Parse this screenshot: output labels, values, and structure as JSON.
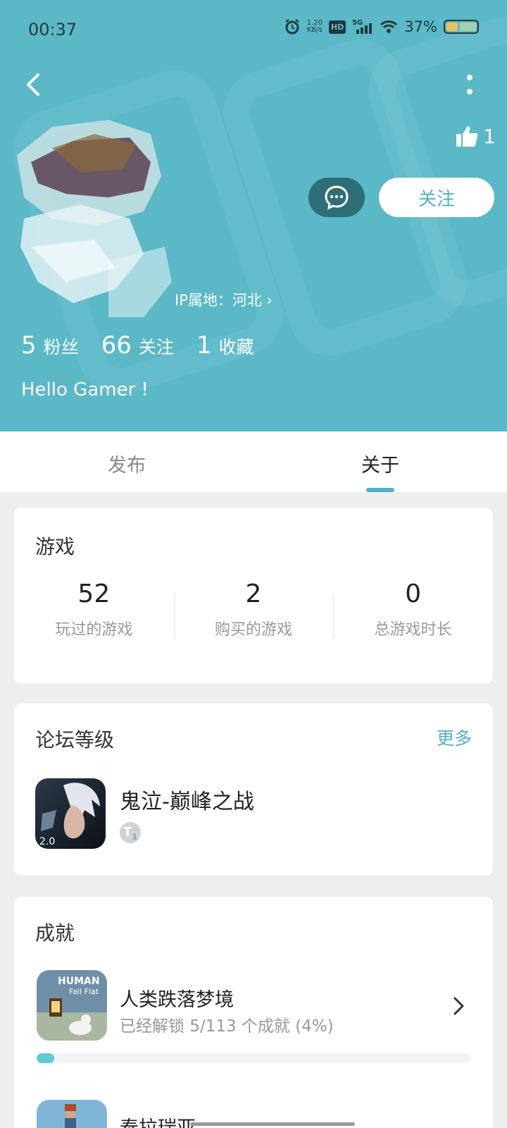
{
  "status_bar": {
    "time": "00:37",
    "net_speed": "1.20",
    "net_unit": "KB/s",
    "hd": "HD",
    "net_type": "5G",
    "battery": "37%",
    "battery_level": 0.37
  },
  "profile": {
    "likes": "1",
    "ip_location": "IP属地：河北 ›",
    "stats": [
      {
        "num": "5",
        "label": "粉丝"
      },
      {
        "num": "66",
        "label": "关注"
      },
      {
        "num": "1",
        "label": "收藏"
      }
    ],
    "bio": "Hello Gamer !",
    "follow_label": "关注"
  },
  "tabs": [
    {
      "label": "发布"
    },
    {
      "label": "关于"
    }
  ],
  "games_card": {
    "title": "游戏",
    "stats": [
      {
        "num": "52",
        "label": "玩过的游戏"
      },
      {
        "num": "2",
        "label": "购买的游戏"
      },
      {
        "num": "0",
        "label": "总游戏时长"
      }
    ]
  },
  "forum_card": {
    "title": "论坛等级",
    "more": "更多",
    "game_name": "鬼泣-巅峰之战",
    "icon_text": "2.0",
    "badge_letter": "T",
    "badge_level": "1"
  },
  "achievements_card": {
    "title": "成就",
    "items": [
      {
        "name": "人类跌落梦境",
        "desc": "已经解锁 5/113 个成就 (4%)",
        "icon_title": "HUMAN",
        "icon_sub": "Fall Flat",
        "progress": 0.04
      },
      {
        "name": "泰拉瑞亚"
      }
    ]
  }
}
